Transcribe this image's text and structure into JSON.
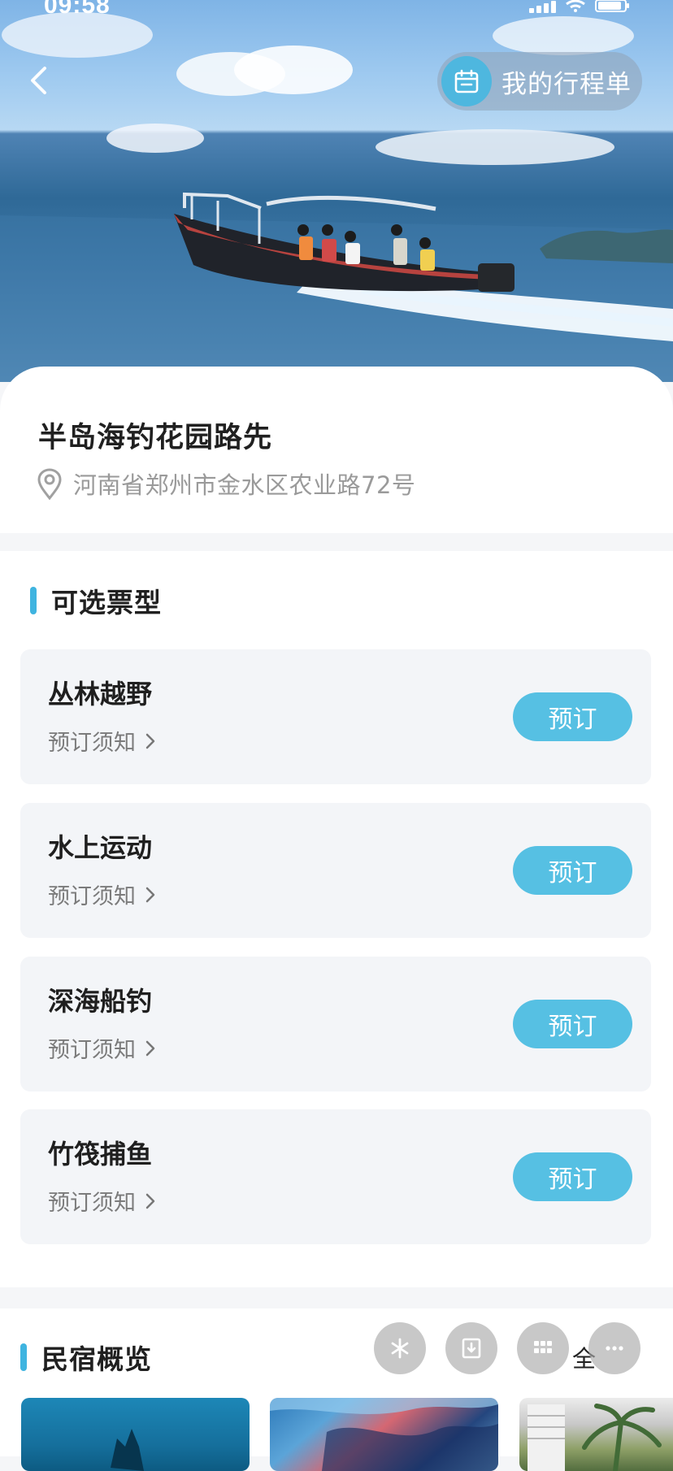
{
  "status_bar": {
    "time": "09:58"
  },
  "header": {
    "itinerary_label": "我的行程单"
  },
  "place": {
    "title": "半岛海钓花园路先",
    "address": "河南省郑州市金水区农业路72号"
  },
  "ticket_section": {
    "title": "可选票型",
    "items": [
      {
        "name": "丛林越野",
        "notice": "预订须知",
        "button": "预订"
      },
      {
        "name": "水上运动",
        "notice": "预订须知",
        "button": "预订"
      },
      {
        "name": "深海船钓",
        "notice": "预订须知",
        "button": "预订"
      },
      {
        "name": "竹筏捕鱼",
        "notice": "预订须知",
        "button": "预订"
      }
    ]
  },
  "homestay_section": {
    "title": "民宿概览",
    "view_all": "全"
  },
  "icons": {
    "back": "back-arrow-icon",
    "calendar": "calendar-icon",
    "location": "location-pin-icon",
    "chevron": "chevron-right-icon",
    "floating_actions": [
      "sparkle-icon",
      "download-icon",
      "grid-icon",
      "more-icon"
    ]
  },
  "colors": {
    "accent": "#3fb4e0",
    "button": "#56c0e3",
    "card_background": "#f3f5f8",
    "page_background": "#f5f6f8"
  }
}
